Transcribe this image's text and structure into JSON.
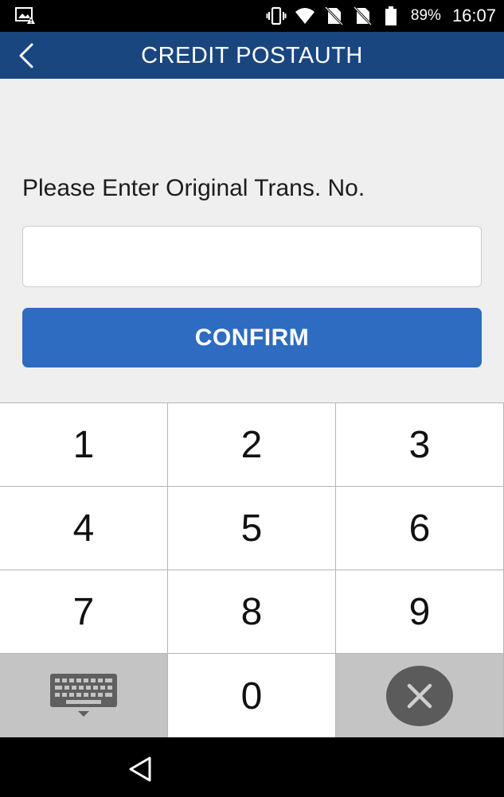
{
  "status_bar": {
    "battery_percent": "89%",
    "time": "16:07"
  },
  "header": {
    "title": "CREDIT POSTAUTH"
  },
  "form": {
    "prompt": "Please Enter Original Trans. No.",
    "input_value": "",
    "input_placeholder": "",
    "confirm_label": "CONFIRM"
  },
  "keypad": {
    "keys": [
      "1",
      "2",
      "3",
      "4",
      "5",
      "6",
      "7",
      "8",
      "9",
      "0"
    ]
  },
  "colors": {
    "header_bg": "#1a4680",
    "accent": "#2d6cc0",
    "page_bg": "#efefef",
    "delete_key": "#5b5b5b"
  }
}
